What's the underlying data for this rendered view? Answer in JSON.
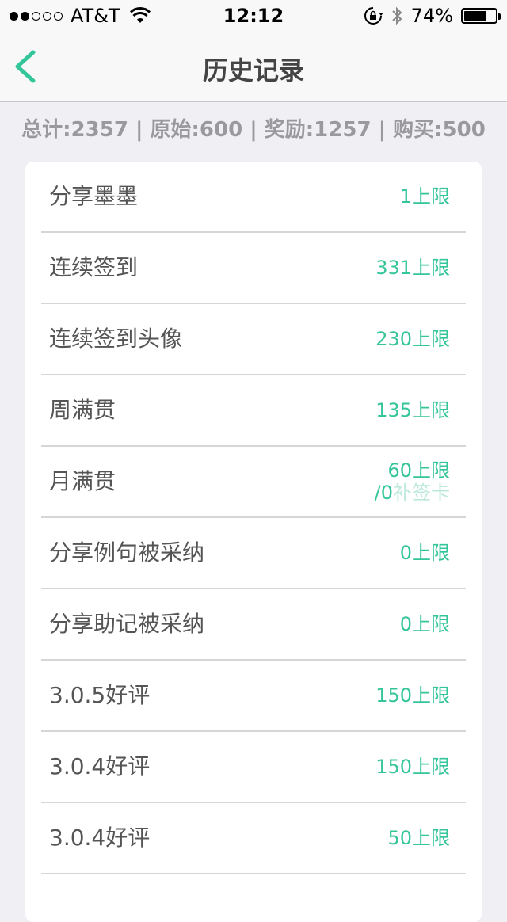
{
  "status": {
    "carrier": "AT&T",
    "time": "12:12",
    "battery": "74%",
    "battery_level": 0.74,
    "icons": [
      "signal-dots-icon",
      "wifi-icon",
      "rotation-lock-icon",
      "bluetooth-icon",
      "battery-icon"
    ]
  },
  "nav": {
    "title": "历史记录",
    "back_icon": "chevron-left-icon"
  },
  "summary": "总计:2357 | 原始:600 | 奖励:1257 | 购买:500",
  "colors": {
    "accent": "#35c59a",
    "background": "#efeff4",
    "text": "#555555"
  },
  "rows": [
    {
      "label": "分享墨墨",
      "value": "1上限"
    },
    {
      "label": "连续签到",
      "value": "331上限"
    },
    {
      "label": "连续签到头像",
      "value": "230上限"
    },
    {
      "label": "周满贯",
      "value": "135上限"
    },
    {
      "label": "月满贯",
      "value": "60上限",
      "sub_prefix": "/0",
      "sub_text": "补签卡"
    },
    {
      "label": "分享例句被采纳",
      "value": "0上限"
    },
    {
      "label": "分享助记被采纳",
      "value": "0上限"
    },
    {
      "label": "3.0.5好评",
      "value": "150上限"
    },
    {
      "label": "3.0.4好评",
      "value": "150上限"
    },
    {
      "label": "3.0.4好评",
      "value": "50上限"
    }
  ]
}
